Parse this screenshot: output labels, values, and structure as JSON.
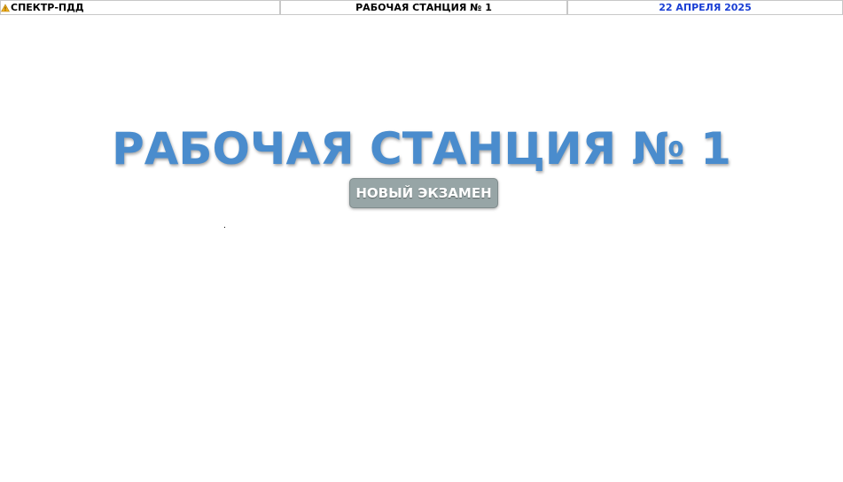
{
  "header": {
    "app_name": "СПЕКТР-ПДД",
    "station": "РАБОЧАЯ СТАНЦИЯ № 1",
    "date": "22 АПРЕЛЯ 2025",
    "app_icon": "warning-triangle-icon",
    "date_color": "#1a3fd4"
  },
  "main": {
    "title": "РАБОЧАЯ СТАНЦИЯ № 1",
    "title_color": "#4a8ccd",
    "new_exam_label": "НОВЫЙ ЭКЗАМЕН",
    "button_color": "#97a5a6"
  }
}
